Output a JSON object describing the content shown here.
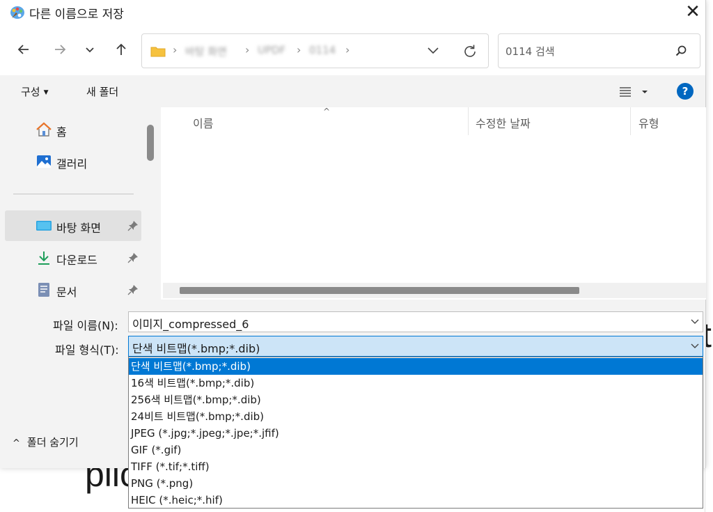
{
  "dialog": {
    "title": "다른 이름으로 저장",
    "close_label": "✕"
  },
  "nav": {
    "back_icon": "back-arrow-icon",
    "forward_icon": "forward-arrow-icon",
    "recent_icon": "chevron-down-icon",
    "up_icon": "up-arrow-icon"
  },
  "address": {
    "crumbs": [
      "바탕 화면",
      "UPDF",
      "0114"
    ],
    "separator": "›"
  },
  "search": {
    "placeholder": "0114 검색"
  },
  "toolbar": {
    "organize_label": "구성",
    "new_folder_label": "새 폴더",
    "help_label": "?"
  },
  "sidebar": {
    "items": [
      {
        "label": "홈",
        "icon": "home-icon",
        "pinned": false
      },
      {
        "label": "갤러리",
        "icon": "gallery-icon",
        "pinned": false
      },
      {
        "label": "바탕 화면",
        "icon": "desktop-icon",
        "pinned": true
      },
      {
        "label": "다운로드",
        "icon": "download-icon",
        "pinned": true
      },
      {
        "label": "문서",
        "icon": "documents-icon",
        "pinned": true
      }
    ]
  },
  "file_list": {
    "columns": [
      "이름",
      "수정한 날짜",
      "유형"
    ],
    "rows": []
  },
  "form": {
    "filename_label": "파일 이름(N):",
    "filename_value": "이미지_compressed_6",
    "filetype_label": "파일 형식(T):",
    "filetype_value": "단색 비트맵(*.bmp;*.dib)",
    "filetype_options": [
      "단색 비트맵(*.bmp;*.dib)",
      "16색 비트맵(*.bmp;*.dib)",
      "256색 비트맵(*.bmp;*.dib)",
      "24비트 비트맵(*.bmp;*.dib)",
      "JPEG (*.jpg;*.jpeg;*.jpe;*.jfif)",
      "GIF (*.gif)",
      "TIFF (*.tif;*.tiff)",
      "PNG (*.png)",
      "HEIC (*.heic;*.hif)"
    ],
    "selected_option_index": 0,
    "hide_folders_label": "폴더 숨기기"
  },
  "colors": {
    "accent": "#0078d4",
    "selection_bg": "#cce4f7",
    "help_blue": "#0067c0",
    "folder_yellow": "#f6c23e"
  }
}
